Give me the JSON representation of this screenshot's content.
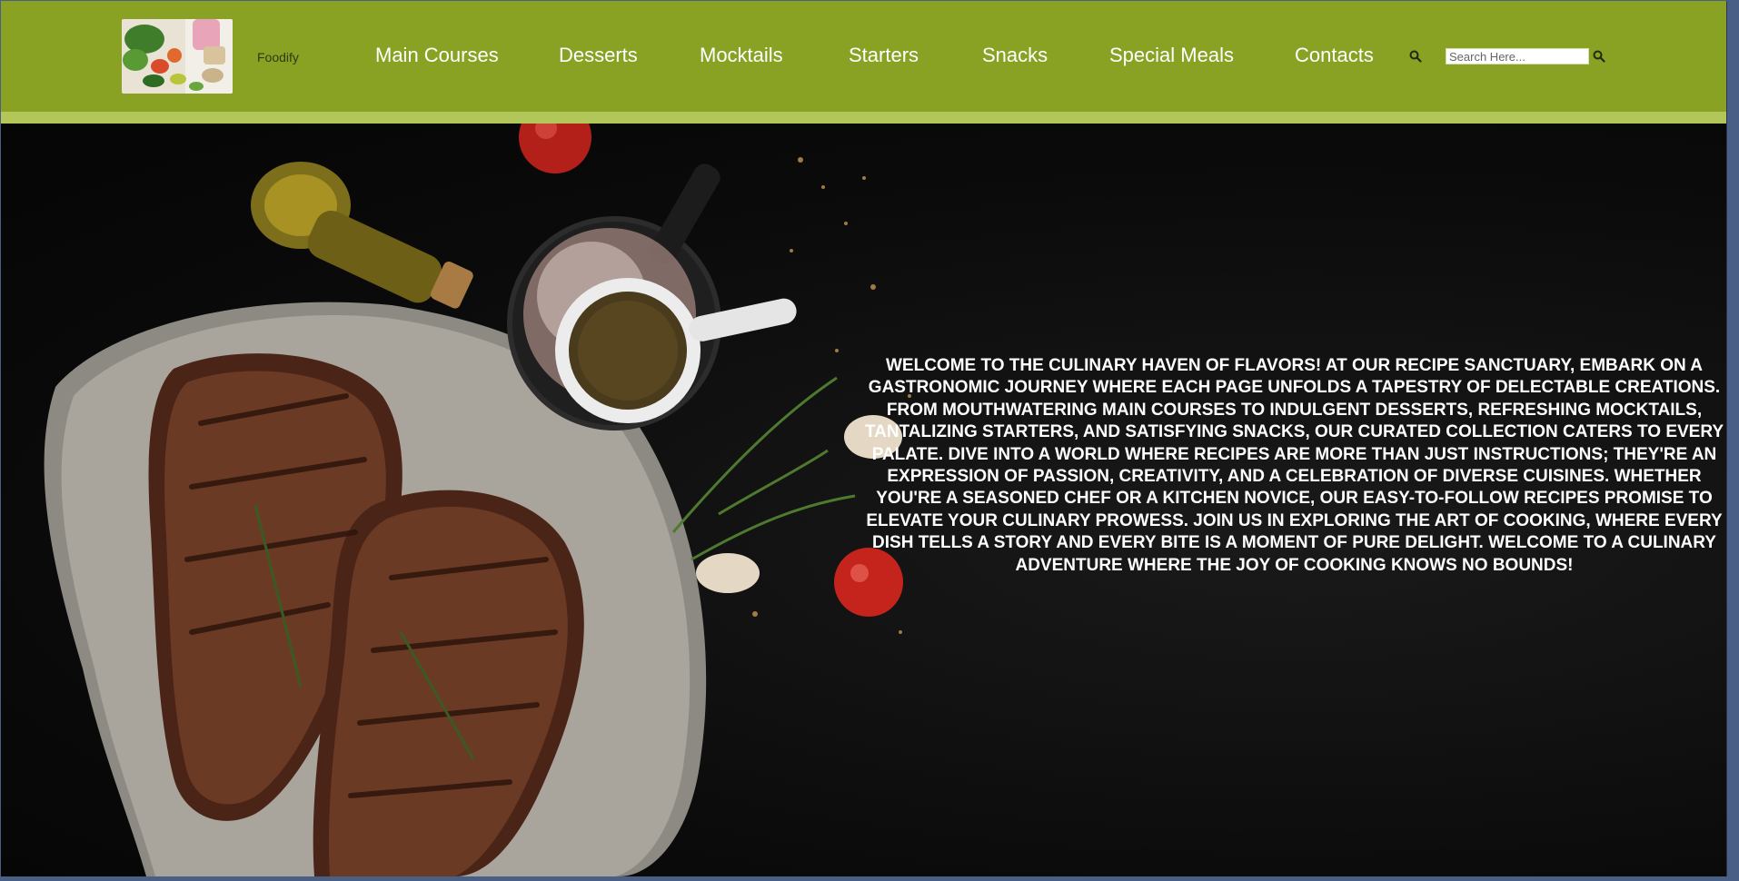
{
  "brand": {
    "name": "Foodify",
    "logo_icon": "vegetables-photo-logo"
  },
  "nav": {
    "items": [
      {
        "label": "Main Courses"
      },
      {
        "label": "Desserts"
      },
      {
        "label": "Mocktails"
      },
      {
        "label": "Starters"
      },
      {
        "label": "Snacks"
      },
      {
        "label": "Special Meals"
      },
      {
        "label": "Contacts"
      }
    ]
  },
  "search": {
    "placeholder": "Search Here...",
    "value": "",
    "icon": "search-icon"
  },
  "hero": {
    "image": "grilled-steak-on-stone-with-spices-photo",
    "text": "Welcome to the Culinary Haven of Flavors! At our recipe sanctuary, embark on a gastronomic journey where each page unfolds a tapestry of delectable creations. From mouthwatering main courses to indulgent desserts, refreshing mocktails, tantalizing starters, and satisfying snacks, our curated collection caters to every palate. Dive into a world where recipes are more than just instructions; they're an expression of passion, creativity, and a celebration of diverse cuisines. Whether you're a seasoned chef or a kitchen novice, our easy-to-follow recipes promise to elevate your culinary prowess. Join us in exploring the art of cooking, where every dish tells a story and every bite is a moment of pure delight. Welcome to a culinary adventure where the joy of cooking knows no bounds!"
  },
  "colors": {
    "navbar": "#89a224",
    "nav_strip": "#b2c65a",
    "hero_bg": "#0b0b0b",
    "text": "#ffffff"
  }
}
